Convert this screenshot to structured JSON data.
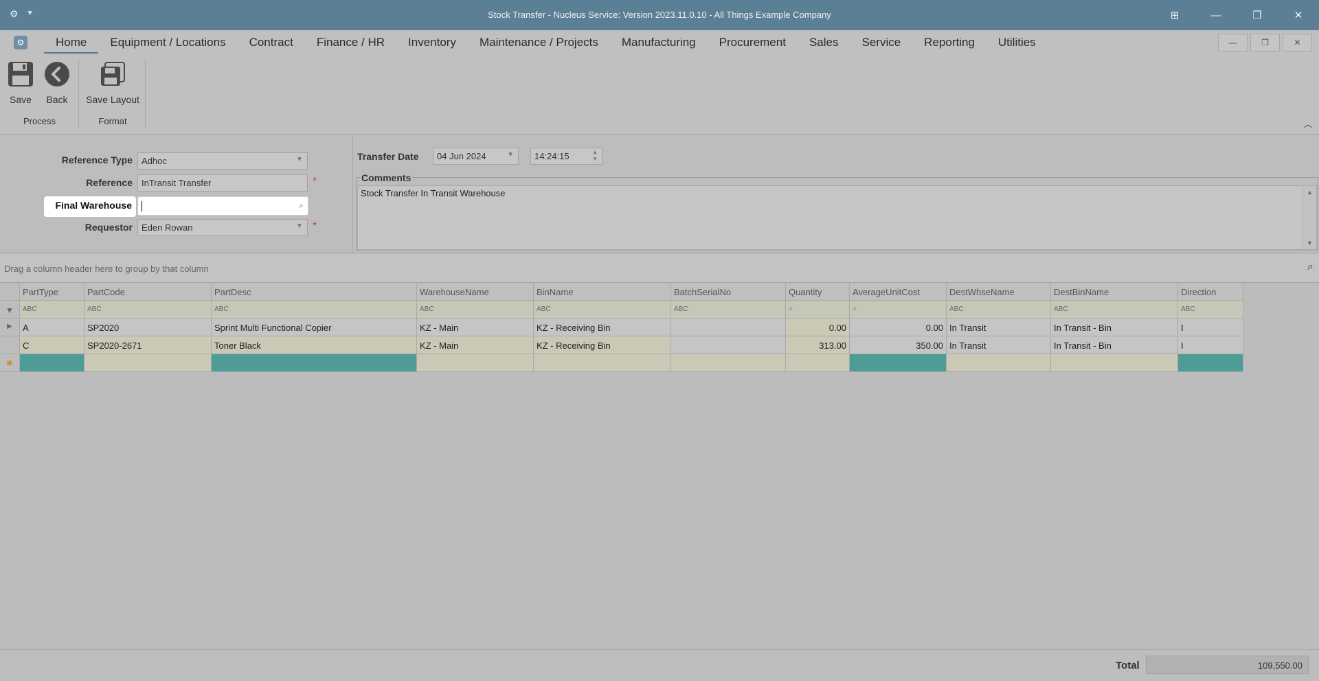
{
  "window": {
    "title": "Stock Transfer - Nucleus Service: Version 2023.11.0.10 - All Things Example Company"
  },
  "menu": {
    "items": [
      "Home",
      "Equipment / Locations",
      "Contract",
      "Finance / HR",
      "Inventory",
      "Maintenance / Projects",
      "Manufacturing",
      "Procurement",
      "Sales",
      "Service",
      "Reporting",
      "Utilities"
    ],
    "active": "Home"
  },
  "ribbon": {
    "save": "Save",
    "back": "Back",
    "save_layout": "Save Layout",
    "group_process": "Process",
    "group_format": "Format"
  },
  "form": {
    "reference_type_label": "Reference Type",
    "reference_type_value": "Adhoc",
    "reference_label": "Reference",
    "reference_value": "InTransit Transfer",
    "final_warehouse_label": "Final Warehouse",
    "final_warehouse_value": "",
    "requestor_label": "Requestor",
    "requestor_value": "Eden Rowan",
    "transfer_date_label": "Transfer Date",
    "transfer_date_value": "04 Jun 2024",
    "transfer_time_value": "14:24:15",
    "comments_label": "Comments",
    "comments_value": "Stock Transfer In Transit Warehouse",
    "required_marker": "*"
  },
  "grid": {
    "group_panel_text": "Drag a column header here to group by that column",
    "columns": [
      "PartType",
      "PartCode",
      "PartDesc",
      "WarehouseName",
      "BinName",
      "BatchSerialNo",
      "Quantity",
      "AverageUnitCost",
      "DestWhseName",
      "DestBinName",
      "Direction"
    ],
    "filter_row": [
      "ABC",
      "ABC",
      "ABC",
      "ABC",
      "ABC",
      "ABC",
      "=",
      "=",
      "ABC",
      "ABC",
      "ABC"
    ],
    "rows": [
      [
        "A",
        "SP2020",
        "Sprint Multi Functional Copier",
        "KZ - Main",
        "KZ - Receiving Bin",
        "",
        "0.00",
        "0.00",
        "In Transit",
        "In Transit - Bin",
        "I"
      ],
      [
        "C",
        "SP2020-2671",
        "Toner Black",
        "KZ - Main",
        "KZ - Receiving Bin",
        "",
        "313.00",
        "350.00",
        "In Transit",
        "In Transit - Bin",
        "I"
      ]
    ]
  },
  "footer": {
    "total_label": "Total",
    "total_value": "109,550.00"
  }
}
